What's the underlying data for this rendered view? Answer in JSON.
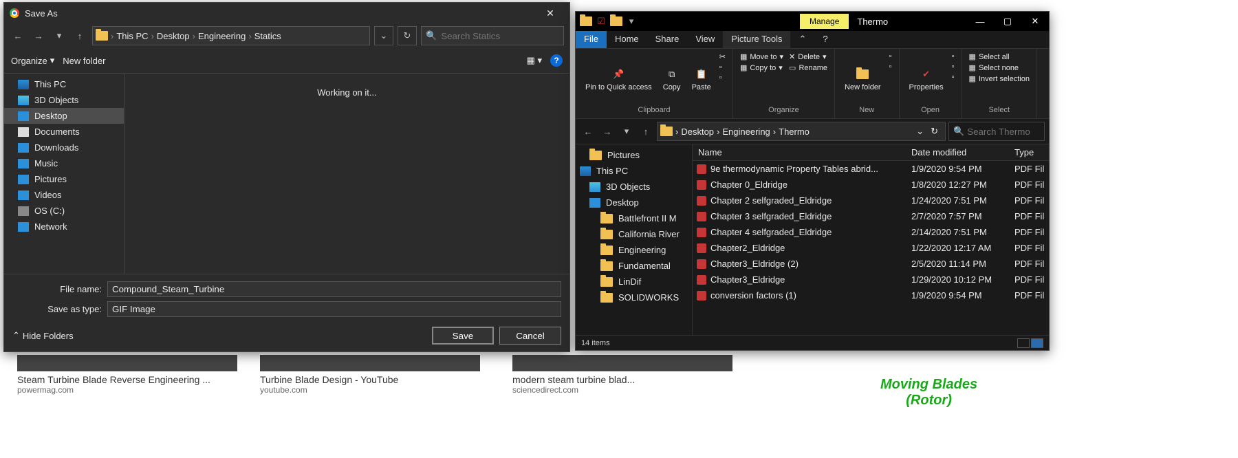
{
  "saveAs": {
    "title": "Save As",
    "breadcrumb": [
      "This PC",
      "Desktop",
      "Engineering",
      "Statics"
    ],
    "searchPlaceholder": "Search Statics",
    "organize": "Organize",
    "newFolder": "New folder",
    "tree": [
      {
        "label": "This PC",
        "icon": "monitor"
      },
      {
        "label": "3D Objects",
        "icon": "cube"
      },
      {
        "label": "Desktop",
        "icon": "desk",
        "selected": true
      },
      {
        "label": "Documents",
        "icon": "doc"
      },
      {
        "label": "Downloads",
        "icon": "dl"
      },
      {
        "label": "Music",
        "icon": "music"
      },
      {
        "label": "Pictures",
        "icon": "pic"
      },
      {
        "label": "Videos",
        "icon": "vid"
      },
      {
        "label": "OS (C:)",
        "icon": "disk"
      },
      {
        "label": "Network",
        "icon": "net"
      }
    ],
    "workingText": "Working on it...",
    "fileNameLabel": "File name:",
    "fileNameValue": "Compound_Steam_Turbine",
    "saveTypeLabel": "Save as type:",
    "saveTypeValue": "GIF Image",
    "hideFolders": "Hide Folders",
    "saveBtn": "Save",
    "cancelBtn": "Cancel"
  },
  "explorer": {
    "tabContext": "Manage",
    "title": "Thermo",
    "tabs": {
      "file": "File",
      "home": "Home",
      "share": "Share",
      "view": "View",
      "picture": "Picture Tools"
    },
    "ribbon": {
      "pin": "Pin to Quick access",
      "copy": "Copy",
      "paste": "Paste",
      "moveTo": "Move to",
      "copyTo": "Copy to",
      "delete": "Delete",
      "rename": "Rename",
      "newFolder": "New folder",
      "properties": "Properties",
      "selectAll": "Select all",
      "selectNone": "Select none",
      "invert": "Invert selection",
      "grpClipboard": "Clipboard",
      "grpOrganize": "Organize",
      "grpNew": "New",
      "grpOpen": "Open",
      "grpSelect": "Select"
    },
    "breadcrumb": [
      "Desktop",
      "Engineering",
      "Thermo"
    ],
    "searchPlaceholder": "Search Thermo",
    "treeTop": {
      "pictures": "Pictures",
      "thisPC": "This PC",
      "objects": "3D Objects",
      "desktop": "Desktop"
    },
    "treeSub": [
      "Battlefront II M",
      "California River",
      "Engineering",
      "Fundamental",
      "LinDif",
      "SOLIDWORKS"
    ],
    "cols": {
      "name": "Name",
      "date": "Date modified",
      "type": "Type"
    },
    "files": [
      {
        "name": "9e thermodynamic Property Tables abrid...",
        "date": "1/9/2020 9:54 PM",
        "type": "PDF Fil"
      },
      {
        "name": "Chapter 0_Eldridge",
        "date": "1/8/2020 12:27 PM",
        "type": "PDF Fil"
      },
      {
        "name": "Chapter 2 selfgraded_Eldridge",
        "date": "1/24/2020 7:51 PM",
        "type": "PDF Fil"
      },
      {
        "name": "Chapter 3 selfgraded_Eldridge",
        "date": "2/7/2020 7:57 PM",
        "type": "PDF Fil"
      },
      {
        "name": "Chapter 4 selfgraded_Eldridge",
        "date": "2/14/2020 7:51 PM",
        "type": "PDF Fil"
      },
      {
        "name": "Chapter2_Eldridge",
        "date": "1/22/2020 12:17 AM",
        "type": "PDF Fil"
      },
      {
        "name": "Chapter3_Eldridge (2)",
        "date": "2/5/2020 11:14 PM",
        "type": "PDF Fil"
      },
      {
        "name": "Chapter3_Eldridge",
        "date": "1/29/2020 10:12 PM",
        "type": "PDF Fil"
      },
      {
        "name": "conversion factors (1)",
        "date": "1/9/2020 9:54 PM",
        "type": "PDF Fil"
      }
    ],
    "status": "14 items"
  },
  "bg": {
    "cards": [
      {
        "title": "Steam Turbine Blade Reverse Engineering ...",
        "src": "powermag.com"
      },
      {
        "title": "Turbine Blade Design - YouTube",
        "src": "youtube.com"
      },
      {
        "title": "modern steam turbine blad...",
        "src": "sciencedirect.com"
      }
    ],
    "rotor1": "Moving Blades",
    "rotor2": "(Rotor)"
  }
}
